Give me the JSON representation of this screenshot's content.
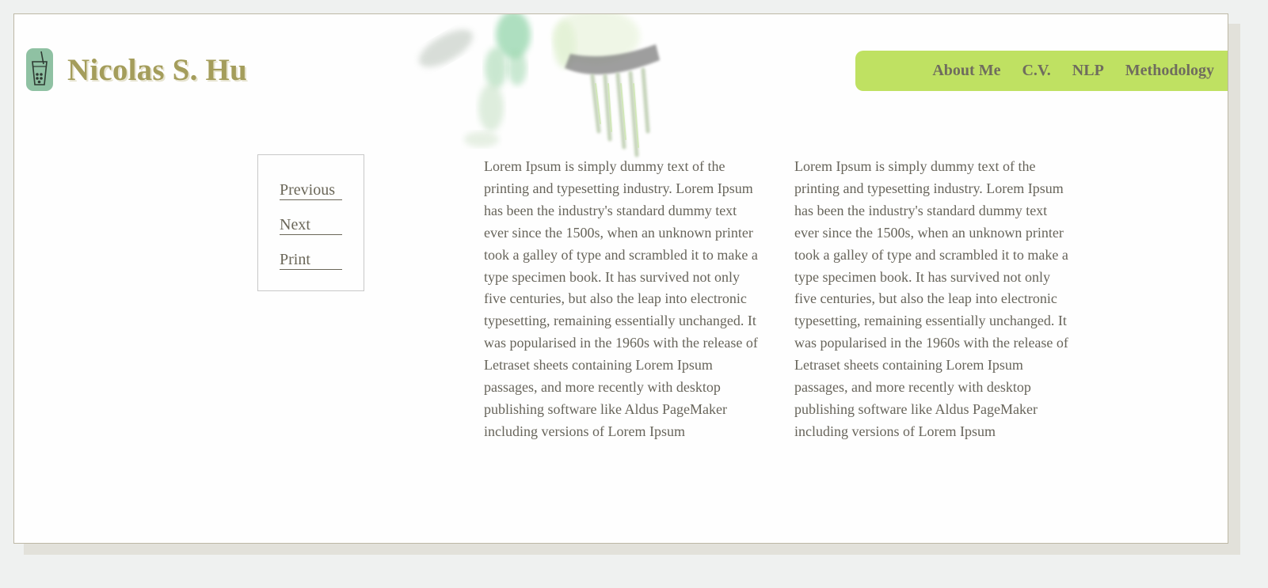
{
  "header": {
    "site_title": "Nicolas S. Hu",
    "logo_icon": "bubble-tea-icon"
  },
  "nav": {
    "items": [
      {
        "label": "About Me"
      },
      {
        "label": "C.V."
      },
      {
        "label": "NLP"
      },
      {
        "label": "Methodology"
      }
    ],
    "background": "#bfe162"
  },
  "pager": {
    "previous": "Previous",
    "next": "Next",
    "print": "Print"
  },
  "content": {
    "column_1": "Lorem Ipsum is simply dummy text of the printing and typesetting industry. Lorem Ipsum has been the industry's standard dummy text ever since the 1500s, when an unknown printer took a galley of type and scrambled it to make a type specimen book. It has survived not only five centuries, but also the leap into electronic typesetting, remaining essentially unchanged. It was popularised in the 1960s with the release of Letraset sheets containing Lorem Ipsum passages, and more recently with desktop publishing software like Aldus PageMaker including versions of Lorem Ipsum",
    "column_2": "Lorem Ipsum is simply dummy text of the printing and typesetting industry. Lorem Ipsum has been the industry's standard dummy text ever since the 1500s, when an unknown printer took a galley of type and scrambled it to make a type specimen book. It has survived not only five centuries, but also the leap into electronic typesetting, remaining essentially unchanged. It was popularised in the 1960s with the release of Letraset sheets containing Lorem Ipsum passages, and more recently with desktop publishing software like Aldus PageMaker including versions of Lorem Ipsum"
  },
  "colors": {
    "title": "#a49d5b",
    "logo": "#8fc1a3",
    "text": "#67645a",
    "page_background": "#eff1f0"
  }
}
